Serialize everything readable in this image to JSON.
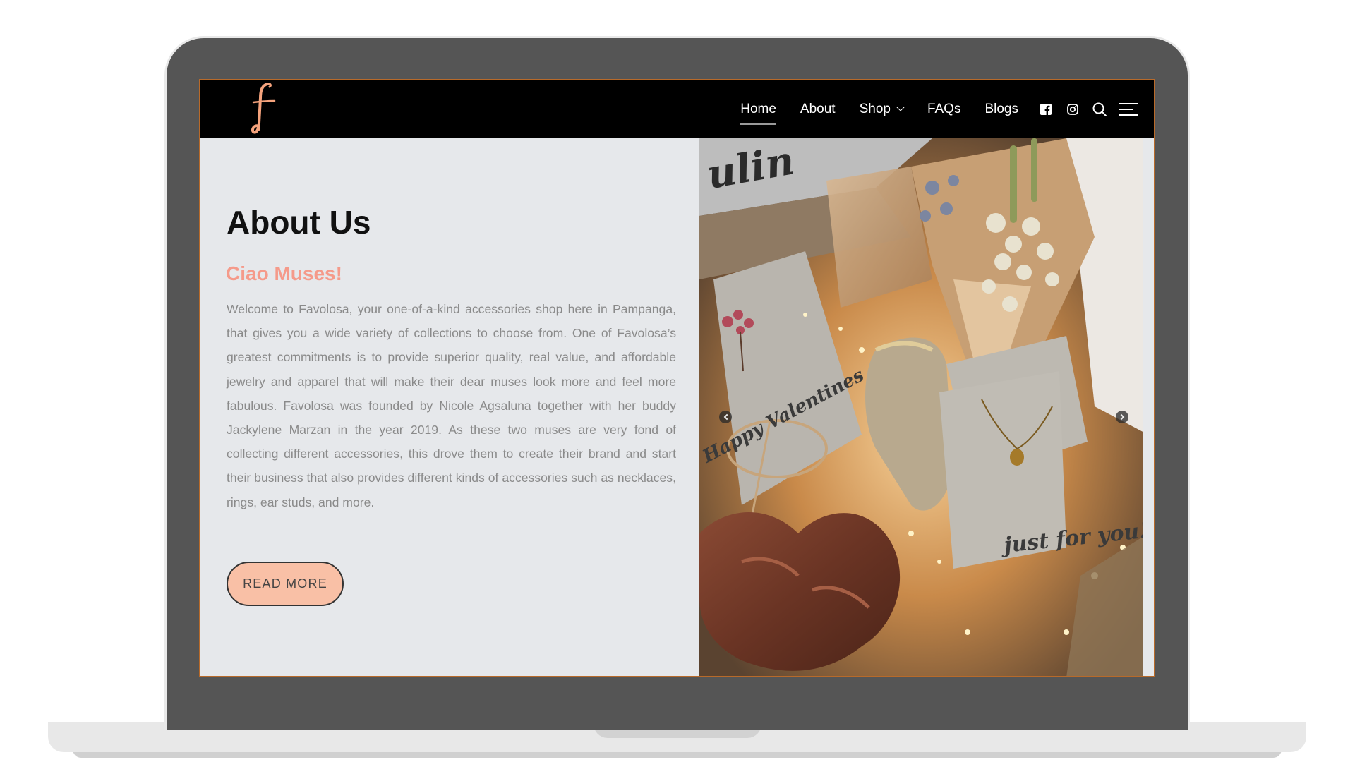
{
  "brand": {
    "logo_letter": "f",
    "logo_color": "#f4a27c"
  },
  "nav": {
    "items": [
      {
        "label": "Home",
        "active": true
      },
      {
        "label": "About",
        "active": false
      },
      {
        "label": "Shop",
        "active": false,
        "has_dropdown": true
      },
      {
        "label": "FAQs",
        "active": false
      },
      {
        "label": "Blogs",
        "active": false
      }
    ],
    "icons": [
      "facebook-icon",
      "instagram-icon",
      "search-icon",
      "menu-icon"
    ]
  },
  "about": {
    "title": "About Us",
    "subtitle": "Ciao Muses!",
    "body": "Welcome to Favolosa, your one-of-a-kind accessories shop here in Pampanga, that gives you a wide variety of collections to choose from. One of Favolosa’s greatest commitments is to provide superior quality, real value, and affordable jewelry and apparel that will make their dear muses look more and feel more fabulous. Favolosa was founded by Nicole Agsaluna together with her buddy Jackylene Marzan in the year 2019. As these two muses are very fond of collecting different accessories, this drove them to create their brand and start their business that also provides different kinds of accessories such as necklaces, rings, ear studs, and more.",
    "button_label": "READ MORE"
  },
  "photo": {
    "card_text_left": "Happy Valentines",
    "card_text_right": "just for you!",
    "box_text": "ulin"
  },
  "colors": {
    "header_bg": "#000000",
    "page_bg": "#e6e8eb",
    "subtitle": "#f59a8a",
    "button_bg": "#f9c0a6",
    "laptop_frame": "#555555"
  }
}
